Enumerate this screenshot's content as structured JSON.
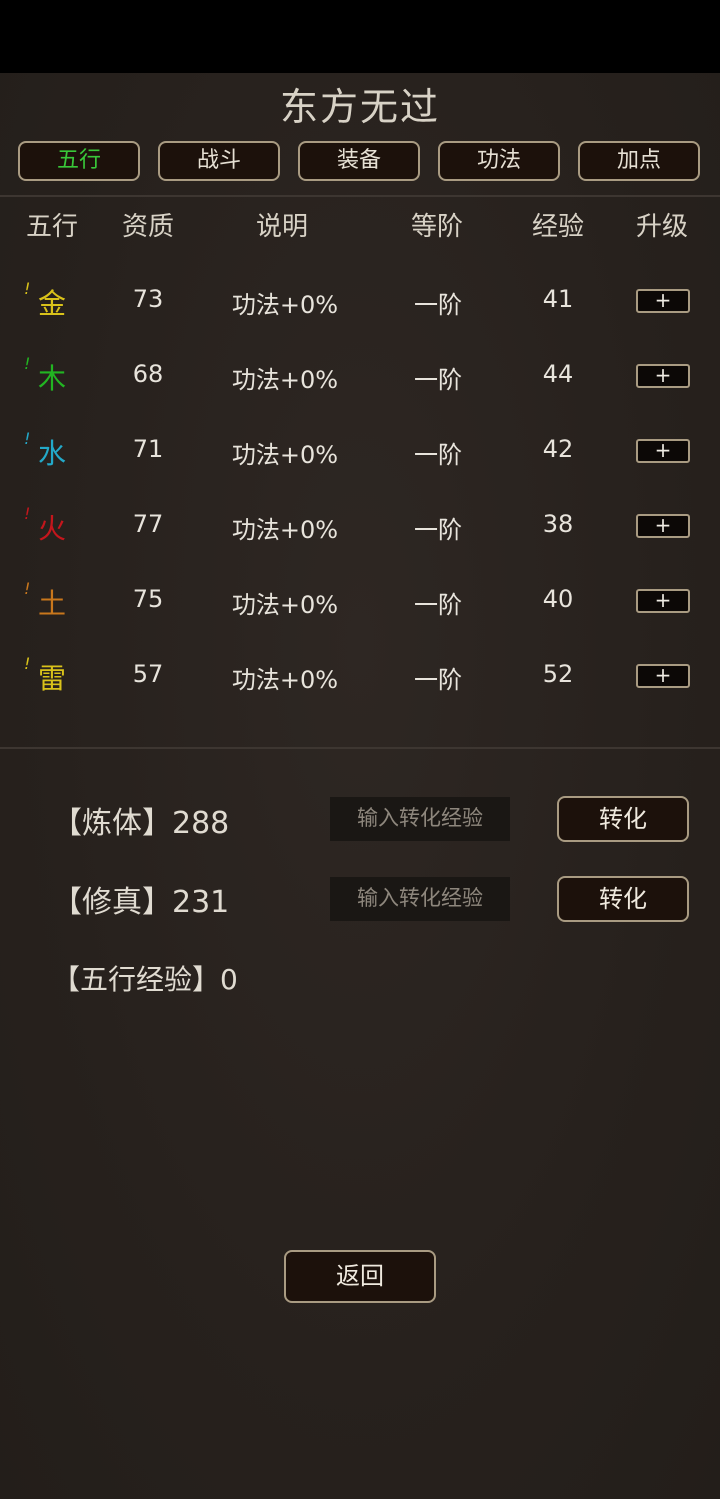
{
  "title": "东方无过",
  "tabs": [
    {
      "label": "五行",
      "active": true
    },
    {
      "label": "战斗",
      "active": false
    },
    {
      "label": "装备",
      "active": false
    },
    {
      "label": "功法",
      "active": false
    },
    {
      "label": "加点",
      "active": false
    }
  ],
  "table": {
    "headers": [
      "五行",
      "资质",
      "说明",
      "等阶",
      "经验",
      "升级"
    ],
    "rows": [
      {
        "element": "金",
        "color": "#d9c21a",
        "bang_color": "#d9c21a",
        "aptitude": "73",
        "desc": "功法+0%",
        "rank": "一阶",
        "exp": "41",
        "upgrade": "+"
      },
      {
        "element": "木",
        "color": "#22b522",
        "bang_color": "#22b522",
        "aptitude": "68",
        "desc": "功法+0%",
        "rank": "一阶",
        "exp": "44",
        "upgrade": "+"
      },
      {
        "element": "水",
        "color": "#23a9c9",
        "bang_color": "#23a9c9",
        "aptitude": "71",
        "desc": "功法+0%",
        "rank": "一阶",
        "exp": "42",
        "upgrade": "+"
      },
      {
        "element": "火",
        "color": "#c4161c",
        "bang_color": "#c4161c",
        "aptitude": "77",
        "desc": "功法+0%",
        "rank": "一阶",
        "exp": "38",
        "upgrade": "+"
      },
      {
        "element": "土",
        "color": "#c9771c",
        "bang_color": "#c9771c",
        "aptitude": "75",
        "desc": "功法+0%",
        "rank": "一阶",
        "exp": "40",
        "upgrade": "+"
      },
      {
        "element": "雷",
        "color": "#d9c21a",
        "bang_color": "#d9c21a",
        "aptitude": "57",
        "desc": "功法+0%",
        "rank": "一阶",
        "exp": "52",
        "upgrade": "+"
      }
    ]
  },
  "bang_symbol": "!",
  "convert": [
    {
      "label": "【炼体】288",
      "placeholder": "输入转化经验",
      "button": "转化"
    },
    {
      "label": "【修真】231",
      "placeholder": "输入转化经验",
      "button": "转化"
    }
  ],
  "five_exp_label": "【五行经验】0",
  "back_label": "返回"
}
